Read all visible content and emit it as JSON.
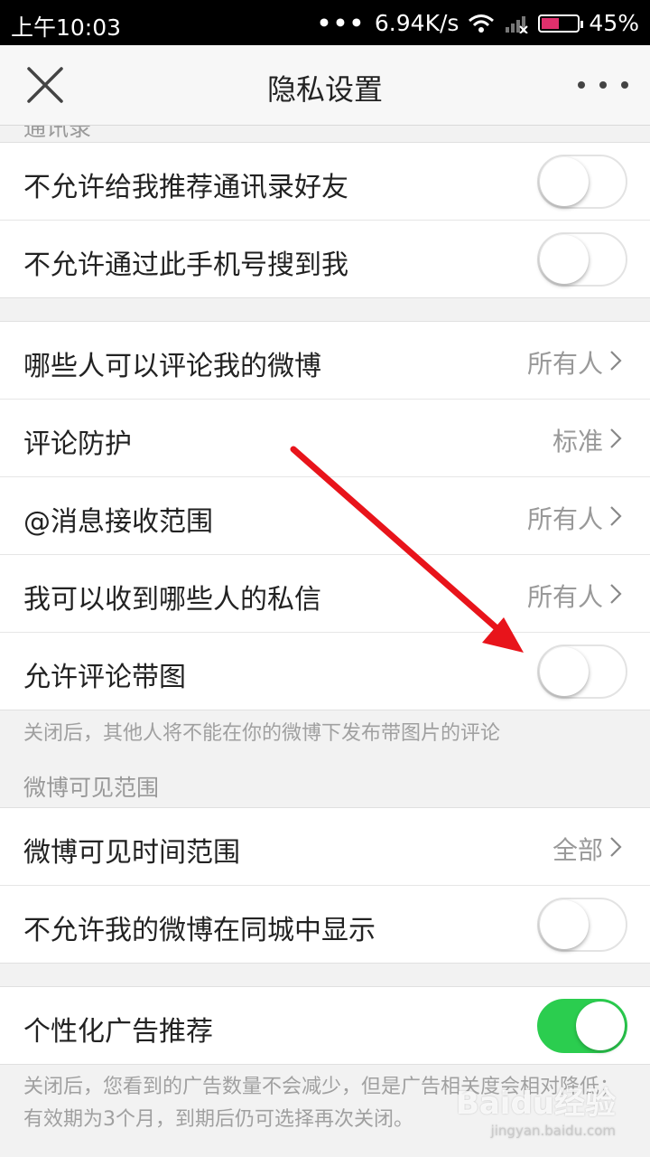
{
  "status_bar": {
    "time": "上午10:03",
    "dots": "•••",
    "speed": "6.94K/s",
    "battery": "45%"
  },
  "nav": {
    "title": "隐私设置"
  },
  "section_contacts": {
    "head": "通讯录"
  },
  "contacts_rows": [
    {
      "label": "不允许给我推荐通讯录好友",
      "toggle": "off"
    },
    {
      "label": "不允许通过此手机号搜到我",
      "toggle": "off"
    }
  ],
  "interaction_rows": [
    {
      "label": "哪些人可以评论我的微博",
      "value": "所有人"
    },
    {
      "label": "评论防护",
      "value": "标准"
    },
    {
      "label": "@消息接收范围",
      "value": "所有人"
    },
    {
      "label": "我可以收到哪些人的私信",
      "value": "所有人"
    },
    {
      "label": "允许评论带图",
      "toggle": "off"
    }
  ],
  "comment_image_note": "关闭后，其他人将不能在你的微博下发布带图片的评论",
  "section_visibility": {
    "head": "微博可见范围"
  },
  "visibility_rows": [
    {
      "label": "微博可见时间范围",
      "value": "全部"
    },
    {
      "label": "不允许我的微博在同城中显示",
      "toggle": "off"
    }
  ],
  "ads_row": {
    "label": "个性化广告推荐",
    "toggle": "on"
  },
  "ads_note": "关闭后，您看到的广告数量不会减少，但是广告相关度会相对降低；有效期为3个月，到期后仍可选择再次关闭。",
  "watermark": {
    "brand": "Baidu经验",
    "url": "jingyan.baidu.com"
  },
  "colors": {
    "toggle_on": "#2bcd4f",
    "arrow": "#e8141b"
  }
}
